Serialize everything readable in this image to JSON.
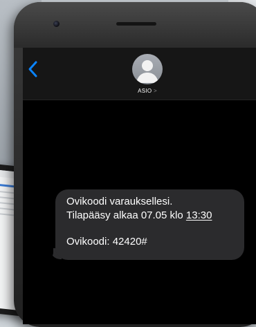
{
  "contact": {
    "name": "ASIO",
    "chevron": ">"
  },
  "message": {
    "line1": "Ovikoodi varauksellesi.",
    "line2_prefix": "Tilapääsy alkaa 07.05 klo ",
    "line2_time": "13:30",
    "line3": "Ovikoodi: 42420#"
  },
  "icons": {
    "back": "chevron-left-icon",
    "avatar": "person-silhouette-icon"
  },
  "colors": {
    "screen_bg": "#000000",
    "nav_bg": "#161616",
    "bubble_bg": "#2b2b2d",
    "accent_blue": "#0a84ff",
    "avatar_gray": "#9a9ea5"
  }
}
